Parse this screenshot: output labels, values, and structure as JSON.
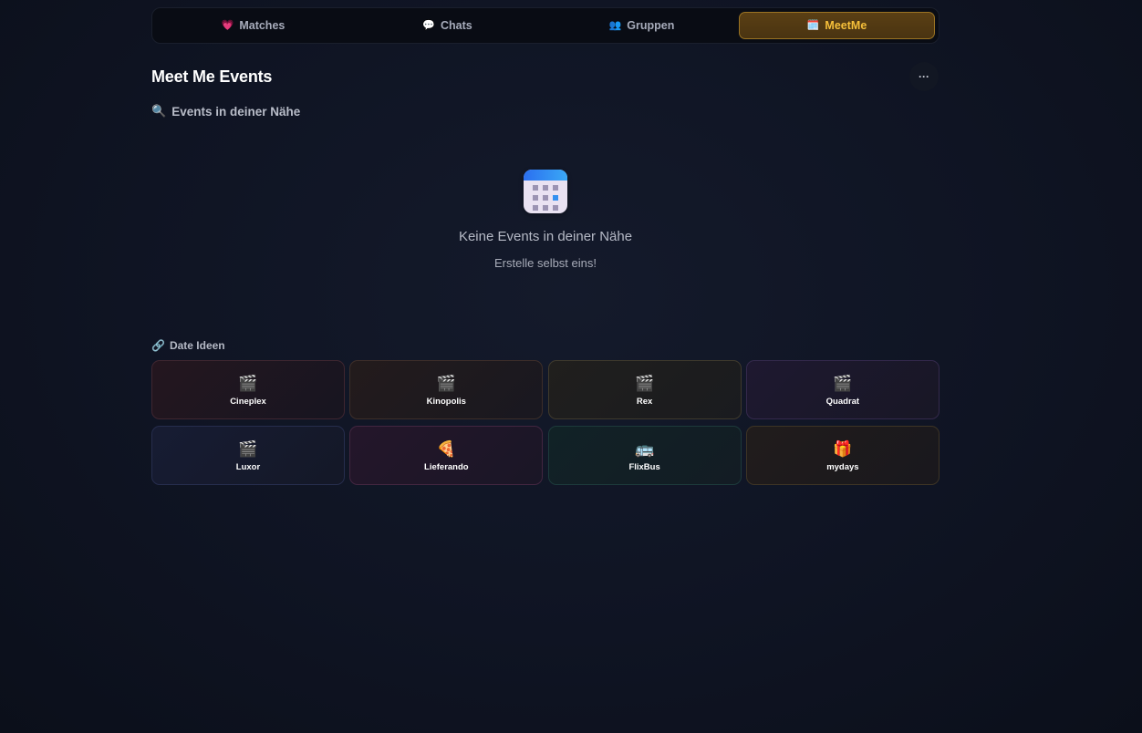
{
  "tabs": [
    {
      "label": "Matches",
      "icon": "heart-icon",
      "glyph": "💗",
      "active": false
    },
    {
      "label": "Chats",
      "icon": "speech-bubble-icon",
      "glyph": "💬",
      "active": false
    },
    {
      "label": "Gruppen",
      "icon": "people-icon",
      "glyph": "👥",
      "active": false
    },
    {
      "label": "MeetMe",
      "icon": "calendar-icon",
      "glyph": "🗓️",
      "active": true
    }
  ],
  "header": {
    "title": "Meet Me Events",
    "more_label": "···"
  },
  "nearby": {
    "icon": "magnifier-icon",
    "glyph": "🔍",
    "title": "Events in deiner Nähe"
  },
  "empty_state": {
    "icon": "calendar-icon",
    "title": "Keine Events in deiner Nähe",
    "subtitle": "Erstelle selbst eins!"
  },
  "date_ideas": {
    "icon": "link-icon",
    "glyph": "🔗",
    "title": "Date Ideen",
    "items": [
      {
        "label": "Cineplex",
        "icon": "clapperboard-icon",
        "glyph": "🎬"
      },
      {
        "label": "Kinopolis",
        "icon": "clapperboard-icon",
        "glyph": "🎬"
      },
      {
        "label": "Rex",
        "icon": "clapperboard-icon",
        "glyph": "🎬"
      },
      {
        "label": "Quadrat",
        "icon": "clapperboard-icon",
        "glyph": "🎬"
      },
      {
        "label": "Luxor",
        "icon": "clapperboard-icon",
        "glyph": "🎬"
      },
      {
        "label": "Lieferando",
        "icon": "pizza-icon",
        "glyph": "🍕"
      },
      {
        "label": "FlixBus",
        "icon": "bus-icon",
        "glyph": "🚌"
      },
      {
        "label": "mydays",
        "icon": "gift-icon",
        "glyph": "🎁"
      }
    ]
  },
  "colors": {
    "background": "#0f1423",
    "active_tab_text": "#f5bf3a",
    "active_tab_border": "#9a7323"
  }
}
